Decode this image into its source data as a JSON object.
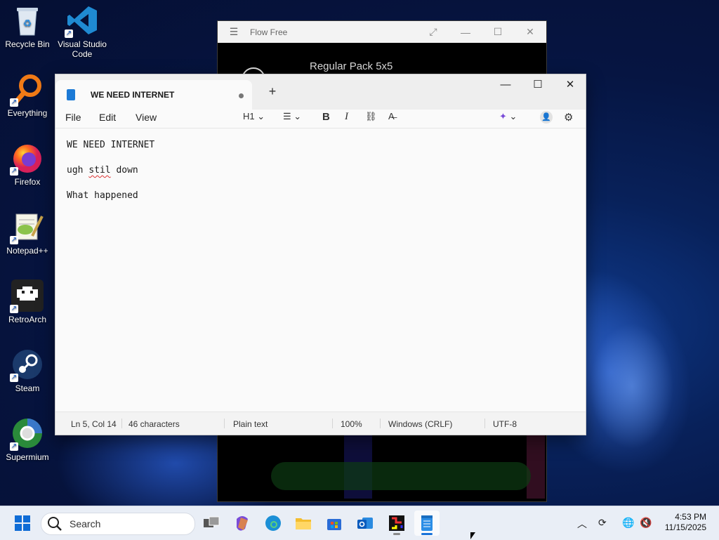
{
  "desktop": {
    "icons": [
      {
        "label": "Recycle Bin"
      },
      {
        "label": "Visual Studio Code"
      },
      {
        "label": "Everything"
      },
      {
        "label": "Firefox"
      },
      {
        "label": "Notepad++"
      },
      {
        "label": "RetroArch"
      },
      {
        "label": "Steam"
      },
      {
        "label": "Supermium"
      }
    ]
  },
  "flow_free": {
    "title": "Flow Free",
    "pack_name": "Regular Pack 5x5"
  },
  "notepad": {
    "tab_title": "WE NEED INTERNET",
    "new_tab": "+",
    "menu": {
      "file": "File",
      "edit": "Edit",
      "view": "View"
    },
    "toolbar": {
      "heading": "H1",
      "bold": "B",
      "italic": "I"
    },
    "lines": [
      "WE NEED INTERNET",
      "ugh ",
      "stil",
      " down",
      "What happened"
    ],
    "status": {
      "position": "Ln 5, Col 14",
      "characters": "46 characters",
      "format": "Plain text",
      "zoom": "100%",
      "line_endings": "Windows (CRLF)",
      "encoding": "UTF-8"
    }
  },
  "taskbar": {
    "search_placeholder": "Search",
    "time": "4:53 PM",
    "date": "11/15/2025"
  },
  "colors": {
    "accent": "#1a73d9",
    "taskbar": "#e9eef6",
    "desktop": "#061542"
  }
}
